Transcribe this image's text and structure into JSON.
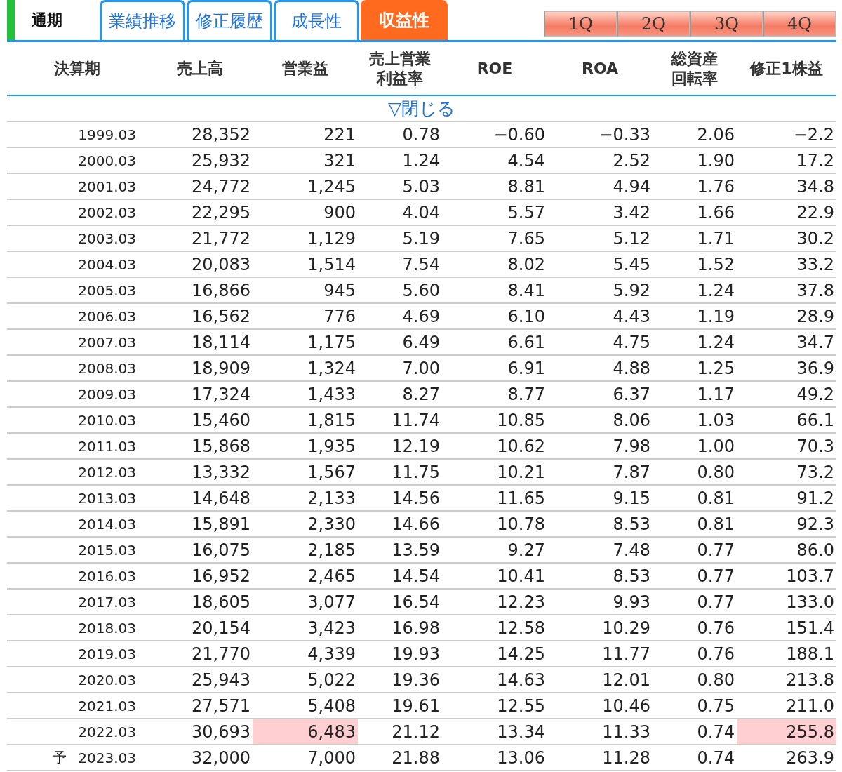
{
  "section_label": "通期",
  "tabs": [
    {
      "label": "業績推移",
      "selected": false
    },
    {
      "label": "修正履歴",
      "selected": false
    },
    {
      "label": "成長性",
      "selected": false
    },
    {
      "label": "収益性",
      "selected": true
    }
  ],
  "quarter_buttons": [
    "1Q",
    "2Q",
    "3Q",
    "4Q"
  ],
  "table": {
    "columns": [
      "決算期",
      "売上高",
      "営業益",
      "売上営業利益率",
      "ROE",
      "ROA",
      "総資産回転率",
      "修正1株益"
    ],
    "toggle": "▽閉じる",
    "rows": [
      {
        "cells": [
          {
            "text": "1999.03",
            "highlighted": false
          },
          {
            "text": "28,352",
            "highlighted": false
          },
          {
            "text": "221",
            "highlighted": false
          },
          {
            "text": "0.78",
            "highlighted": false
          },
          {
            "text": "−0.60",
            "highlighted": false
          },
          {
            "text": "−0.33",
            "highlighted": false
          },
          {
            "text": "2.06",
            "highlighted": false
          },
          {
            "text": "−2.2",
            "highlighted": false
          }
        ]
      },
      {
        "cells": [
          {
            "text": "2000.03",
            "highlighted": false
          },
          {
            "text": "25,932",
            "highlighted": false
          },
          {
            "text": "321",
            "highlighted": false
          },
          {
            "text": "1.24",
            "highlighted": false
          },
          {
            "text": "4.54",
            "highlighted": false
          },
          {
            "text": "2.52",
            "highlighted": false
          },
          {
            "text": "1.90",
            "highlighted": false
          },
          {
            "text": "17.2",
            "highlighted": false
          }
        ]
      },
      {
        "cells": [
          {
            "text": "2001.03",
            "highlighted": false
          },
          {
            "text": "24,772",
            "highlighted": false
          },
          {
            "text": "1,245",
            "highlighted": false
          },
          {
            "text": "5.03",
            "highlighted": false
          },
          {
            "text": "8.81",
            "highlighted": false
          },
          {
            "text": "4.94",
            "highlighted": false
          },
          {
            "text": "1.76",
            "highlighted": false
          },
          {
            "text": "34.8",
            "highlighted": false
          }
        ]
      },
      {
        "cells": [
          {
            "text": "2002.03",
            "highlighted": false
          },
          {
            "text": "22,295",
            "highlighted": false
          },
          {
            "text": "900",
            "highlighted": false
          },
          {
            "text": "4.04",
            "highlighted": false
          },
          {
            "text": "5.57",
            "highlighted": false
          },
          {
            "text": "3.42",
            "highlighted": false
          },
          {
            "text": "1.66",
            "highlighted": false
          },
          {
            "text": "22.9",
            "highlighted": false
          }
        ]
      },
      {
        "cells": [
          {
            "text": "2003.03",
            "highlighted": false
          },
          {
            "text": "21,772",
            "highlighted": false
          },
          {
            "text": "1,129",
            "highlighted": false
          },
          {
            "text": "5.19",
            "highlighted": false
          },
          {
            "text": "7.65",
            "highlighted": false
          },
          {
            "text": "5.12",
            "highlighted": false
          },
          {
            "text": "1.71",
            "highlighted": false
          },
          {
            "text": "30.2",
            "highlighted": false
          }
        ]
      },
      {
        "cells": [
          {
            "text": "2004.03",
            "highlighted": false
          },
          {
            "text": "20,083",
            "highlighted": false
          },
          {
            "text": "1,514",
            "highlighted": false
          },
          {
            "text": "7.54",
            "highlighted": false
          },
          {
            "text": "8.02",
            "highlighted": false
          },
          {
            "text": "5.45",
            "highlighted": false
          },
          {
            "text": "1.52",
            "highlighted": false
          },
          {
            "text": "33.2",
            "highlighted": false
          }
        ]
      },
      {
        "cells": [
          {
            "text": "2005.03",
            "highlighted": false
          },
          {
            "text": "16,866",
            "highlighted": false
          },
          {
            "text": "945",
            "highlighted": false
          },
          {
            "text": "5.60",
            "highlighted": false
          },
          {
            "text": "8.41",
            "highlighted": false
          },
          {
            "text": "5.92",
            "highlighted": false
          },
          {
            "text": "1.24",
            "highlighted": false
          },
          {
            "text": "37.8",
            "highlighted": false
          }
        ]
      },
      {
        "cells": [
          {
            "text": "2006.03",
            "highlighted": false
          },
          {
            "text": "16,562",
            "highlighted": false
          },
          {
            "text": "776",
            "highlighted": false
          },
          {
            "text": "4.69",
            "highlighted": false
          },
          {
            "text": "6.10",
            "highlighted": false
          },
          {
            "text": "4.43",
            "highlighted": false
          },
          {
            "text": "1.19",
            "highlighted": false
          },
          {
            "text": "28.9",
            "highlighted": false
          }
        ]
      },
      {
        "cells": [
          {
            "text": "2007.03",
            "highlighted": false
          },
          {
            "text": "18,114",
            "highlighted": false
          },
          {
            "text": "1,175",
            "highlighted": false
          },
          {
            "text": "6.49",
            "highlighted": false
          },
          {
            "text": "6.61",
            "highlighted": false
          },
          {
            "text": "4.75",
            "highlighted": false
          },
          {
            "text": "1.24",
            "highlighted": false
          },
          {
            "text": "34.7",
            "highlighted": false
          }
        ]
      },
      {
        "cells": [
          {
            "text": "2008.03",
            "highlighted": false
          },
          {
            "text": "18,909",
            "highlighted": false
          },
          {
            "text": "1,324",
            "highlighted": false
          },
          {
            "text": "7.00",
            "highlighted": false
          },
          {
            "text": "6.91",
            "highlighted": false
          },
          {
            "text": "4.88",
            "highlighted": false
          },
          {
            "text": "1.25",
            "highlighted": false
          },
          {
            "text": "36.9",
            "highlighted": false
          }
        ]
      },
      {
        "cells": [
          {
            "text": "2009.03",
            "highlighted": false
          },
          {
            "text": "17,324",
            "highlighted": false
          },
          {
            "text": "1,433",
            "highlighted": false
          },
          {
            "text": "8.27",
            "highlighted": false
          },
          {
            "text": "8.77",
            "highlighted": false
          },
          {
            "text": "6.37",
            "highlighted": false
          },
          {
            "text": "1.17",
            "highlighted": false
          },
          {
            "text": "49.2",
            "highlighted": false
          }
        ]
      },
      {
        "cells": [
          {
            "text": "2010.03",
            "highlighted": false
          },
          {
            "text": "15,460",
            "highlighted": false
          },
          {
            "text": "1,815",
            "highlighted": false
          },
          {
            "text": "11.74",
            "highlighted": false
          },
          {
            "text": "10.85",
            "highlighted": false
          },
          {
            "text": "8.06",
            "highlighted": false
          },
          {
            "text": "1.03",
            "highlighted": false
          },
          {
            "text": "66.1",
            "highlighted": false
          }
        ]
      },
      {
        "cells": [
          {
            "text": "2011.03",
            "highlighted": false
          },
          {
            "text": "15,868",
            "highlighted": false
          },
          {
            "text": "1,935",
            "highlighted": false
          },
          {
            "text": "12.19",
            "highlighted": false
          },
          {
            "text": "10.62",
            "highlighted": false
          },
          {
            "text": "7.98",
            "highlighted": false
          },
          {
            "text": "1.00",
            "highlighted": false
          },
          {
            "text": "70.3",
            "highlighted": false
          }
        ]
      },
      {
        "cells": [
          {
            "text": "2012.03",
            "highlighted": false
          },
          {
            "text": "13,332",
            "highlighted": false
          },
          {
            "text": "1,567",
            "highlighted": false
          },
          {
            "text": "11.75",
            "highlighted": false
          },
          {
            "text": "10.21",
            "highlighted": false
          },
          {
            "text": "7.87",
            "highlighted": false
          },
          {
            "text": "0.80",
            "highlighted": false
          },
          {
            "text": "73.2",
            "highlighted": false
          }
        ]
      },
      {
        "cells": [
          {
            "text": "2013.03",
            "highlighted": false
          },
          {
            "text": "14,648",
            "highlighted": false
          },
          {
            "text": "2,133",
            "highlighted": false
          },
          {
            "text": "14.56",
            "highlighted": false
          },
          {
            "text": "11.65",
            "highlighted": false
          },
          {
            "text": "9.15",
            "highlighted": false
          },
          {
            "text": "0.81",
            "highlighted": false
          },
          {
            "text": "91.2",
            "highlighted": false
          }
        ]
      },
      {
        "cells": [
          {
            "text": "2014.03",
            "highlighted": false
          },
          {
            "text": "15,891",
            "highlighted": false
          },
          {
            "text": "2,330",
            "highlighted": false
          },
          {
            "text": "14.66",
            "highlighted": false
          },
          {
            "text": "10.78",
            "highlighted": false
          },
          {
            "text": "8.53",
            "highlighted": false
          },
          {
            "text": "0.81",
            "highlighted": false
          },
          {
            "text": "92.3",
            "highlighted": false
          }
        ]
      },
      {
        "cells": [
          {
            "text": "2015.03",
            "highlighted": false
          },
          {
            "text": "16,075",
            "highlighted": false
          },
          {
            "text": "2,185",
            "highlighted": false
          },
          {
            "text": "13.59",
            "highlighted": false
          },
          {
            "text": "9.27",
            "highlighted": false
          },
          {
            "text": "7.48",
            "highlighted": false
          },
          {
            "text": "0.77",
            "highlighted": false
          },
          {
            "text": "86.0",
            "highlighted": false
          }
        ]
      },
      {
        "cells": [
          {
            "text": "2016.03",
            "highlighted": false
          },
          {
            "text": "16,952",
            "highlighted": false
          },
          {
            "text": "2,465",
            "highlighted": false
          },
          {
            "text": "14.54",
            "highlighted": false
          },
          {
            "text": "10.41",
            "highlighted": false
          },
          {
            "text": "8.53",
            "highlighted": false
          },
          {
            "text": "0.77",
            "highlighted": false
          },
          {
            "text": "103.7",
            "highlighted": false
          }
        ]
      },
      {
        "cells": [
          {
            "text": "2017.03",
            "highlighted": false
          },
          {
            "text": "18,605",
            "highlighted": false
          },
          {
            "text": "3,077",
            "highlighted": false
          },
          {
            "text": "16.54",
            "highlighted": false
          },
          {
            "text": "12.23",
            "highlighted": false
          },
          {
            "text": "9.93",
            "highlighted": false
          },
          {
            "text": "0.77",
            "highlighted": false
          },
          {
            "text": "133.0",
            "highlighted": false
          }
        ]
      },
      {
        "cells": [
          {
            "text": "2018.03",
            "highlighted": false
          },
          {
            "text": "20,154",
            "highlighted": false
          },
          {
            "text": "3,423",
            "highlighted": false
          },
          {
            "text": "16.98",
            "highlighted": false
          },
          {
            "text": "12.58",
            "highlighted": false
          },
          {
            "text": "10.29",
            "highlighted": false
          },
          {
            "text": "0.76",
            "highlighted": false
          },
          {
            "text": "151.4",
            "highlighted": false
          }
        ]
      },
      {
        "cells": [
          {
            "text": "2019.03",
            "highlighted": false
          },
          {
            "text": "21,770",
            "highlighted": false
          },
          {
            "text": "4,339",
            "highlighted": false
          },
          {
            "text": "19.93",
            "highlighted": false
          },
          {
            "text": "14.25",
            "highlighted": false
          },
          {
            "text": "11.77",
            "highlighted": false
          },
          {
            "text": "0.76",
            "highlighted": false
          },
          {
            "text": "188.1",
            "highlighted": false
          }
        ]
      },
      {
        "cells": [
          {
            "text": "2020.03",
            "highlighted": false
          },
          {
            "text": "25,943",
            "highlighted": false
          },
          {
            "text": "5,022",
            "highlighted": false
          },
          {
            "text": "19.36",
            "highlighted": false
          },
          {
            "text": "14.63",
            "highlighted": false
          },
          {
            "text": "12.01",
            "highlighted": false
          },
          {
            "text": "0.80",
            "highlighted": false
          },
          {
            "text": "213.8",
            "highlighted": false
          }
        ]
      },
      {
        "cells": [
          {
            "text": "2021.03",
            "highlighted": false
          },
          {
            "text": "27,571",
            "highlighted": false
          },
          {
            "text": "5,408",
            "highlighted": false
          },
          {
            "text": "19.61",
            "highlighted": false
          },
          {
            "text": "12.55",
            "highlighted": false
          },
          {
            "text": "10.46",
            "highlighted": false
          },
          {
            "text": "0.75",
            "highlighted": false
          },
          {
            "text": "211.0",
            "highlighted": false
          }
        ]
      },
      {
        "cells": [
          {
            "text": "2022.03",
            "highlighted": false
          },
          {
            "text": "30,693",
            "highlighted": false
          },
          {
            "text": "6,483",
            "highlighted": true
          },
          {
            "text": "21.12",
            "highlighted": false
          },
          {
            "text": "13.34",
            "highlighted": false
          },
          {
            "text": "11.33",
            "highlighted": false
          },
          {
            "text": "0.74",
            "highlighted": false
          },
          {
            "text": "255.8",
            "highlighted": true
          }
        ]
      },
      {
        "prefix": "予",
        "cells": [
          {
            "text": "2023.03",
            "highlighted": false
          },
          {
            "text": "32,000",
            "highlighted": false
          },
          {
            "text": "7,000",
            "highlighted": false
          },
          {
            "text": "21.88",
            "highlighted": false
          },
          {
            "text": "13.06",
            "highlighted": false
          },
          {
            "text": "11.28",
            "highlighted": false
          },
          {
            "text": "0.74",
            "highlighted": false
          },
          {
            "text": "263.9",
            "highlighted": false
          }
        ]
      }
    ]
  }
}
